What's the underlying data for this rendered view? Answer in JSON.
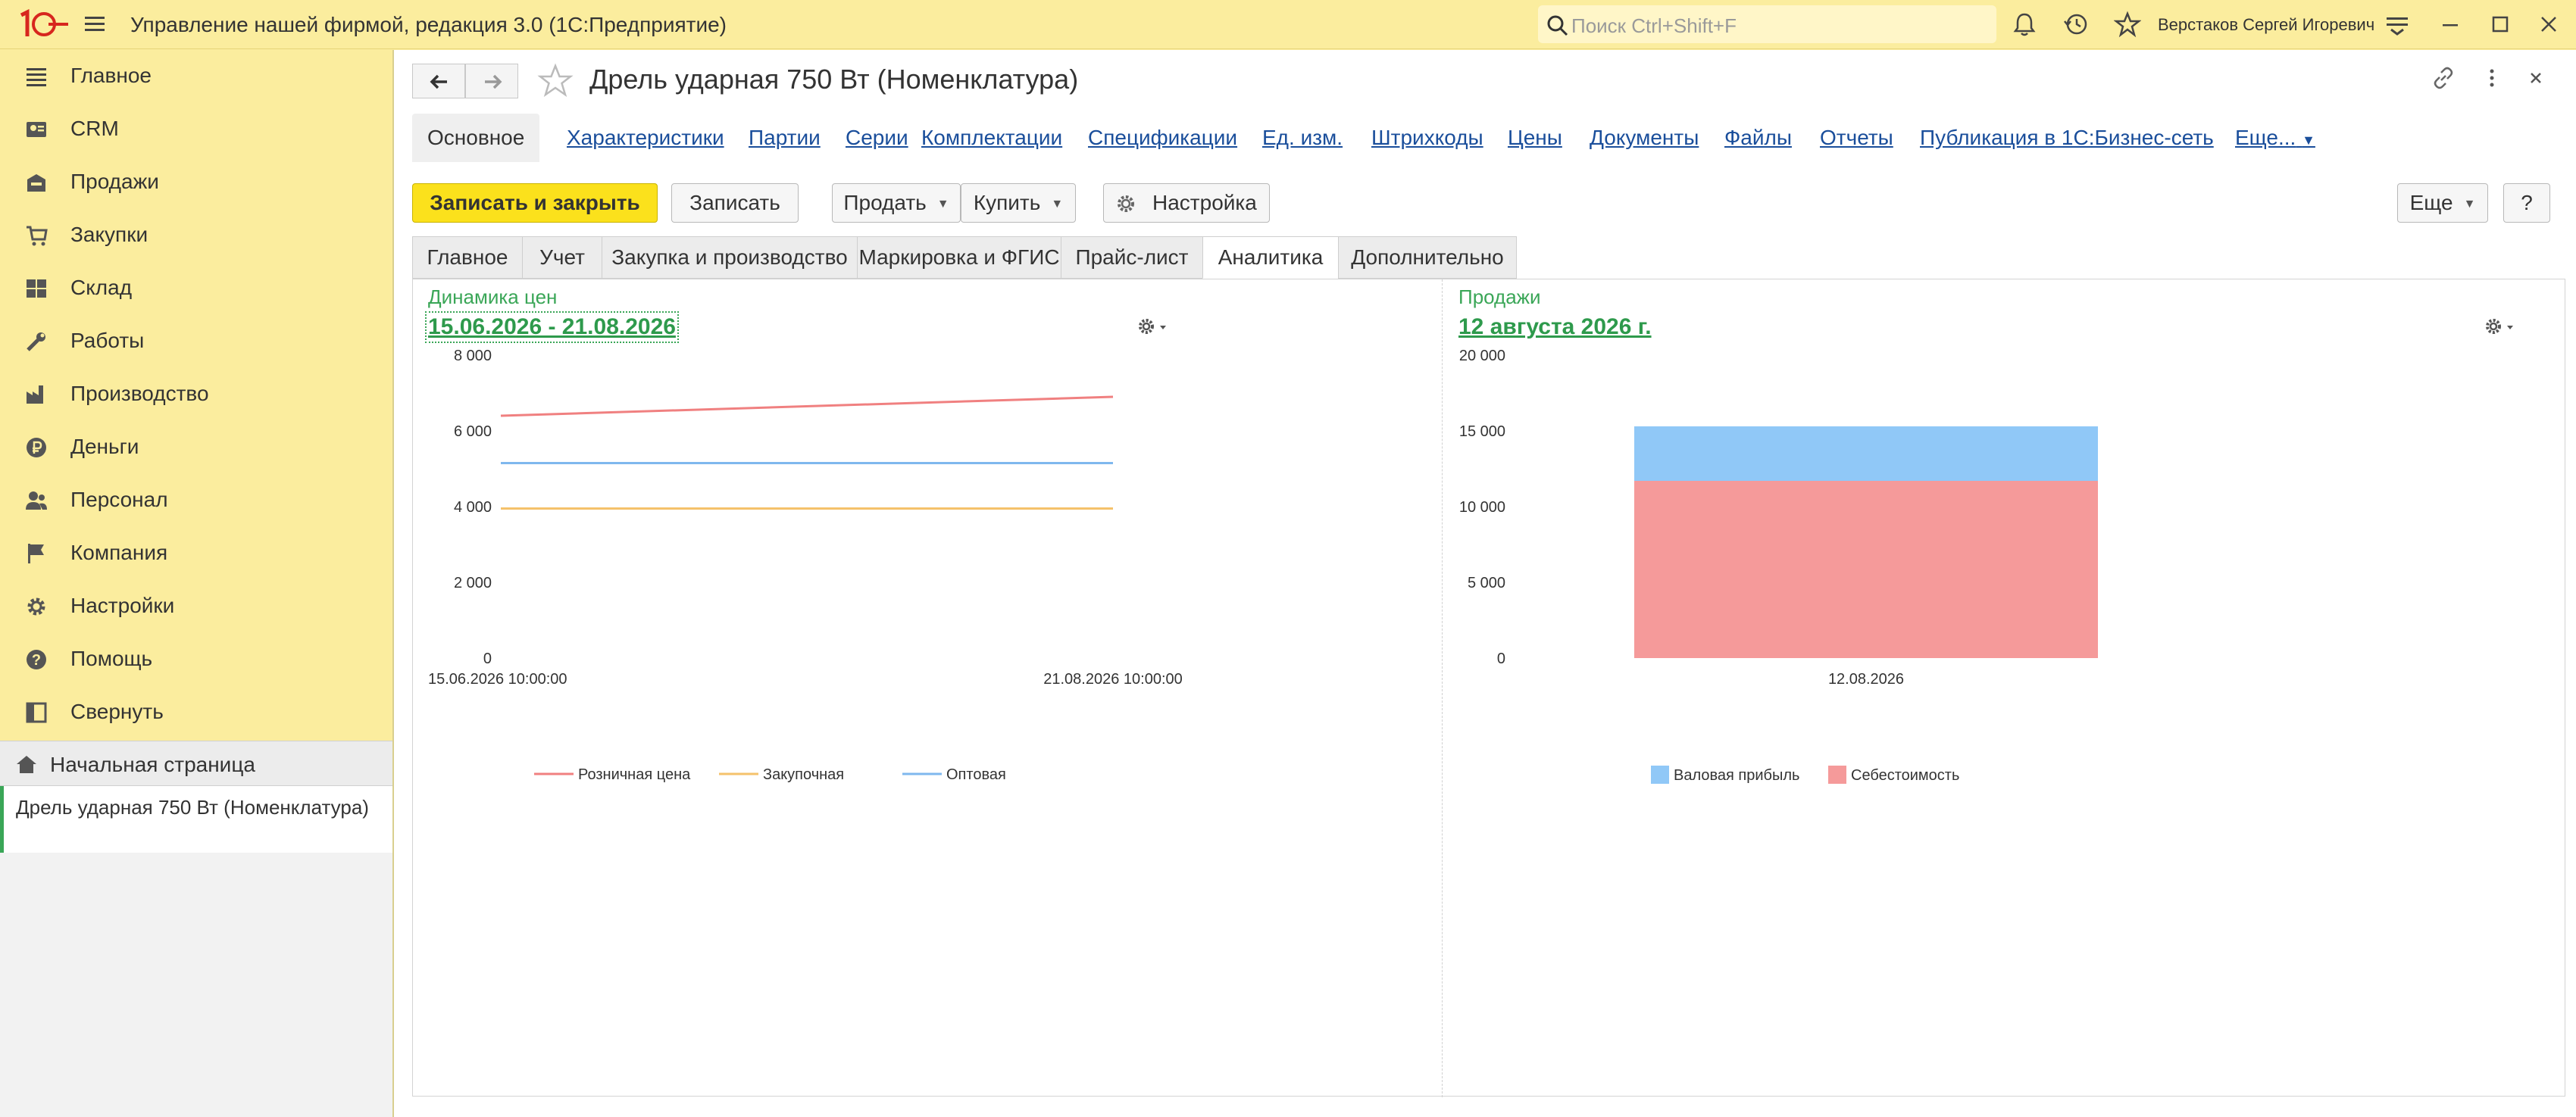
{
  "app": {
    "title": "Управление нашей фирмой, редакция 3.0  (1С:Предприятие)",
    "search_placeholder": "Поиск Ctrl+Shift+F",
    "user_name": "Верстаков Сергей Игоревич",
    "logo_text": "1С"
  },
  "sidebar": {
    "items": [
      {
        "label": "Главное",
        "icon": "list-icon"
      },
      {
        "label": "CRM",
        "icon": "crm-icon"
      },
      {
        "label": "Продажи",
        "icon": "sales-icon"
      },
      {
        "label": "Закупки",
        "icon": "cart-icon"
      },
      {
        "label": "Склад",
        "icon": "warehouse-icon"
      },
      {
        "label": "Работы",
        "icon": "tools-icon"
      },
      {
        "label": "Производство",
        "icon": "factory-icon"
      },
      {
        "label": "Деньги",
        "icon": "ruble-icon"
      },
      {
        "label": "Персонал",
        "icon": "people-icon"
      },
      {
        "label": "Компания",
        "icon": "flag-icon"
      },
      {
        "label": "Настройки",
        "icon": "gear-icon"
      },
      {
        "label": "Помощь",
        "icon": "help-icon"
      },
      {
        "label": "Свернуть",
        "icon": "collapse-icon"
      }
    ],
    "home_label": "Начальная страница",
    "open_doc_label": "Дрель ударная 750 Вт (Номенклатура)"
  },
  "form": {
    "title": "Дрель ударная 750 Вт (Номенклатура)",
    "links": [
      {
        "label": "Основное",
        "active": true
      },
      {
        "label": "Характеристики"
      },
      {
        "label": "Партии"
      },
      {
        "label": "Серии"
      },
      {
        "label": "Комплектации"
      },
      {
        "label": "Спецификации"
      },
      {
        "label": "Ед. изм."
      },
      {
        "label": "Штрихкоды"
      },
      {
        "label": "Цены"
      },
      {
        "label": "Документы"
      },
      {
        "label": "Файлы"
      },
      {
        "label": "Отчеты"
      },
      {
        "label": "Публикация в 1С:Бизнес-сеть"
      },
      {
        "label": "Еще..."
      }
    ],
    "buttons": {
      "save_close": "Записать и закрыть",
      "save": "Записать",
      "sell": "Продать",
      "buy": "Купить",
      "settings": "Настройка",
      "more": "Еще",
      "help": "?"
    },
    "tabs": [
      {
        "label": "Главное"
      },
      {
        "label": "Учет"
      },
      {
        "label": "Закупка и производство"
      },
      {
        "label": "Маркировка и ФГИС"
      },
      {
        "label": "Прайс-лист"
      },
      {
        "label": "Аналитика",
        "active": true
      },
      {
        "label": "Дополнительно"
      }
    ]
  },
  "chart_data": [
    {
      "type": "line",
      "title": "Динамика  цен",
      "period": "15.06.2026 - 21.08.2026",
      "x": [
        "15.06.2026 10:00:00",
        "21.08.2026 10:00:00"
      ],
      "ylim": [
        0,
        8000
      ],
      "yticks": [
        "8 000",
        "6 000",
        "4 000",
        "2 000",
        "0"
      ],
      "series": [
        {
          "name": "Розничная цена",
          "color": "#f08080",
          "values": [
            6400,
            6900
          ]
        },
        {
          "name": "Закупочная",
          "color": "#f5c26b",
          "values": [
            3950,
            3950
          ]
        },
        {
          "name": "Оптовая",
          "color": "#7fb8ee",
          "values": [
            5150,
            5150
          ]
        }
      ],
      "legend": "bottom"
    },
    {
      "type": "bar",
      "stacked": true,
      "title": "Продажи",
      "period": "12 августа 2026 г.",
      "categories": [
        "12.08.2026"
      ],
      "ylim": [
        0,
        20000
      ],
      "yticks": [
        "20 000",
        "15 000",
        "10 000",
        "5 000",
        "0"
      ],
      "series": [
        {
          "name": "Валовая прибыль",
          "color": "#90c8f7",
          "values": [
            3600
          ]
        },
        {
          "name": "Себестоимость",
          "color": "#f59a9a",
          "values": [
            11700
          ]
        }
      ],
      "legend": "bottom"
    }
  ]
}
